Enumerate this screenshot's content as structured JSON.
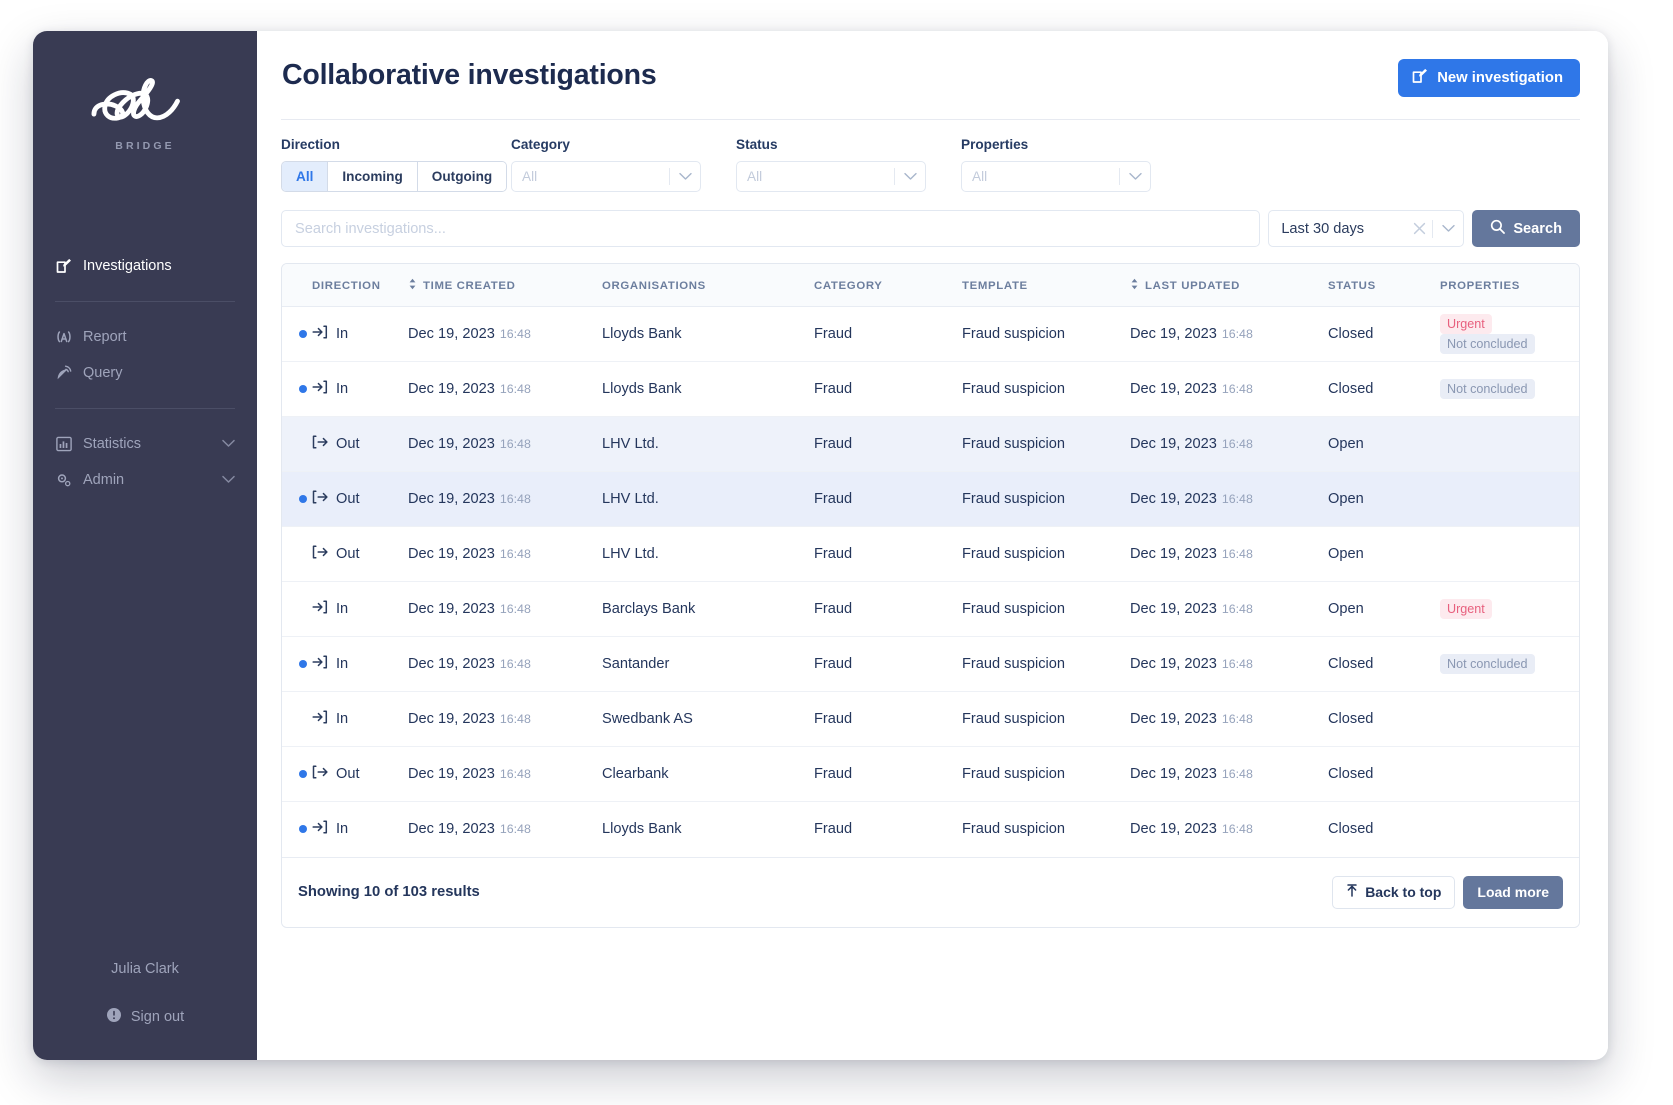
{
  "sidebar": {
    "logo_text": "salv",
    "logo_sub": "BRIDGE",
    "nav_primary": [
      {
        "label": "Investigations",
        "icon": "edit-square-icon"
      }
    ],
    "nav_secondary": [
      {
        "label": "Report",
        "icon": "broadcast-icon"
      },
      {
        "label": "Query",
        "icon": "satellite-dish-icon"
      }
    ],
    "nav_tertiary": [
      {
        "label": "Statistics",
        "icon": "bar-chart-icon",
        "expandable": true
      },
      {
        "label": "Admin",
        "icon": "gears-icon",
        "expandable": true
      }
    ],
    "user_name": "Julia Clark",
    "sign_out": "Sign out"
  },
  "header": {
    "title": "Collaborative investigations",
    "new_investigation": "New investigation"
  },
  "filters": {
    "direction": {
      "label": "Direction",
      "options": [
        "All",
        "Incoming",
        "Outgoing"
      ],
      "selected": "All"
    },
    "category": {
      "label": "Category",
      "placeholder": "All",
      "value": ""
    },
    "status": {
      "label": "Status",
      "placeholder": "All",
      "value": ""
    },
    "properties": {
      "label": "Properties",
      "placeholder": "All",
      "value": ""
    }
  },
  "search": {
    "placeholder": "Search investigations...",
    "value": "",
    "date_range": "Last 30 days",
    "button": "Search"
  },
  "table": {
    "columns": [
      {
        "key": "direction",
        "label": "DIRECTION",
        "sortable": false
      },
      {
        "key": "time_created",
        "label": "TIME CREATED",
        "sortable": true
      },
      {
        "key": "organisations",
        "label": "ORGANISATIONS",
        "sortable": false
      },
      {
        "key": "category",
        "label": "CATEGORY",
        "sortable": false
      },
      {
        "key": "template",
        "label": "TEMPLATE",
        "sortable": false
      },
      {
        "key": "last_updated",
        "label": "LAST UPDATED",
        "sortable": true
      },
      {
        "key": "status",
        "label": "STATUS",
        "sortable": false
      },
      {
        "key": "properties",
        "label": "PROPERTIES",
        "sortable": false
      }
    ],
    "rows": [
      {
        "unread": true,
        "direction": "In",
        "date": "Dec 19, 2023",
        "time": "16:48",
        "organisation": "Lloyds Bank",
        "category": "Fraud",
        "template": "Fraud suspicion",
        "updated_date": "Dec 19, 2023",
        "updated_time": "16:48",
        "status": "Closed",
        "properties": [
          "Urgent",
          "Not concluded"
        ],
        "highlight": ""
      },
      {
        "unread": true,
        "direction": "In",
        "date": "Dec 19, 2023",
        "time": "16:48",
        "organisation": "Lloyds Bank",
        "category": "Fraud",
        "template": "Fraud suspicion",
        "updated_date": "Dec 19, 2023",
        "updated_time": "16:48",
        "status": "Closed",
        "properties": [
          "Not concluded"
        ],
        "highlight": ""
      },
      {
        "unread": false,
        "direction": "Out",
        "date": "Dec 19, 2023",
        "time": "16:48",
        "organisation": "LHV Ltd.",
        "category": "Fraud",
        "template": "Fraud suspicion",
        "updated_date": "Dec 19, 2023",
        "updated_time": "16:48",
        "status": "Open",
        "properties": [],
        "highlight": "sel-a"
      },
      {
        "unread": true,
        "direction": "Out",
        "date": "Dec 19, 2023",
        "time": "16:48",
        "organisation": "LHV Ltd.",
        "category": "Fraud",
        "template": "Fraud suspicion",
        "updated_date": "Dec 19, 2023",
        "updated_time": "16:48",
        "status": "Open",
        "properties": [],
        "highlight": "sel-b"
      },
      {
        "unread": false,
        "direction": "Out",
        "date": "Dec 19, 2023",
        "time": "16:48",
        "organisation": "LHV Ltd.",
        "category": "Fraud",
        "template": "Fraud suspicion",
        "updated_date": "Dec 19, 2023",
        "updated_time": "16:48",
        "status": "Open",
        "properties": [],
        "highlight": ""
      },
      {
        "unread": false,
        "direction": "In",
        "date": "Dec 19, 2023",
        "time": "16:48",
        "organisation": "Barclays Bank",
        "category": "Fraud",
        "template": "Fraud suspicion",
        "updated_date": "Dec 19, 2023",
        "updated_time": "16:48",
        "status": "Open",
        "properties": [
          "Urgent"
        ],
        "highlight": ""
      },
      {
        "unread": true,
        "direction": "In",
        "date": "Dec 19, 2023",
        "time": "16:48",
        "organisation": "Santander",
        "category": "Fraud",
        "template": "Fraud suspicion",
        "updated_date": "Dec 19, 2023",
        "updated_time": "16:48",
        "status": "Closed",
        "properties": [
          "Not concluded"
        ],
        "highlight": ""
      },
      {
        "unread": false,
        "direction": "In",
        "date": "Dec 19, 2023",
        "time": "16:48",
        "organisation": "Swedbank AS",
        "category": "Fraud",
        "template": "Fraud suspicion",
        "updated_date": "Dec 19, 2023",
        "updated_time": "16:48",
        "status": "Closed",
        "properties": [],
        "highlight": ""
      },
      {
        "unread": true,
        "direction": "Out",
        "date": "Dec 19, 2023",
        "time": "16:48",
        "organisation": "Clearbank",
        "category": "Fraud",
        "template": "Fraud suspicion",
        "updated_date": "Dec 19, 2023",
        "updated_time": "16:48",
        "status": "Closed",
        "properties": [],
        "highlight": ""
      },
      {
        "unread": true,
        "direction": "In",
        "date": "Dec 19, 2023",
        "time": "16:48",
        "organisation": "Lloyds Bank",
        "category": "Fraud",
        "template": "Fraud suspicion",
        "updated_date": "Dec 19, 2023",
        "updated_time": "16:48",
        "status": "Closed",
        "properties": [],
        "highlight": ""
      }
    ]
  },
  "footer": {
    "results": "Showing 10 of 103 results",
    "back_to_top": "Back to top",
    "load_more": "Load more"
  },
  "colors": {
    "sidebar_bg": "#393b53",
    "accent_blue": "#2f77e8",
    "grey_button": "#64779c",
    "urgent_tag": "#e8607e",
    "neutral_tag": "#8a97b2"
  }
}
